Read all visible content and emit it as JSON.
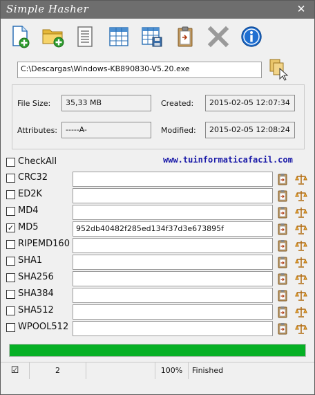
{
  "window": {
    "title": "Simple Hasher",
    "close_glyph": "✕"
  },
  "toolbar": {
    "buttons": [
      {
        "name": "new-file-button",
        "icon": "new-file-icon"
      },
      {
        "name": "open-folder-button",
        "icon": "open-folder-icon"
      },
      {
        "name": "text-view-button",
        "icon": "document-icon"
      },
      {
        "name": "table-view-button",
        "icon": "table-icon"
      },
      {
        "name": "save-table-button",
        "icon": "save-table-icon"
      },
      {
        "name": "copy-button",
        "icon": "clipboard-icon"
      },
      {
        "name": "clear-button",
        "icon": "x-icon"
      },
      {
        "name": "info-button",
        "icon": "info-icon"
      }
    ]
  },
  "file": {
    "path": "C:\\Descargas\\Windows-KB890830-V5.20.exe",
    "browse_icon": "file-cursor-icon"
  },
  "info": {
    "size_label": "File Size:",
    "size_value": "35,33 MB",
    "attributes_label": "Attributes:",
    "attributes_value": "-----A-",
    "created_label": "Created:",
    "created_value": "2015-02-05 12:07:34",
    "modified_label": "Modified:",
    "modified_value": "2015-02-05 12:08:24"
  },
  "check_all": {
    "label": "CheckAll",
    "checked": false
  },
  "link": {
    "text": "www.tuinformaticafacil.com"
  },
  "hashes": [
    {
      "label": "CRC32",
      "checked": false,
      "value": ""
    },
    {
      "label": "ED2K",
      "checked": false,
      "value": ""
    },
    {
      "label": "MD4",
      "checked": false,
      "value": ""
    },
    {
      "label": "MD5",
      "checked": true,
      "value": "952db40482f285ed134f37d3e673895f"
    },
    {
      "label": "RIPEMD160",
      "checked": false,
      "value": ""
    },
    {
      "label": "SHA1",
      "checked": false,
      "value": ""
    },
    {
      "label": "SHA256",
      "checked": false,
      "value": ""
    },
    {
      "label": "SHA384",
      "checked": false,
      "value": ""
    },
    {
      "label": "SHA512",
      "checked": false,
      "value": ""
    },
    {
      "label": "WPOOL512",
      "checked": false,
      "value": ""
    }
  ],
  "row_icons": {
    "copy": "copy-hash-icon",
    "compare": "scales-icon"
  },
  "progress": {
    "percent": 100
  },
  "status": {
    "check_glyph": "☑",
    "count": "2",
    "percent": "100%",
    "state": "Finished"
  },
  "colors": {
    "titlebar": "#6e6e6e",
    "progress": "#06b025",
    "link": "#1a1aa8"
  }
}
